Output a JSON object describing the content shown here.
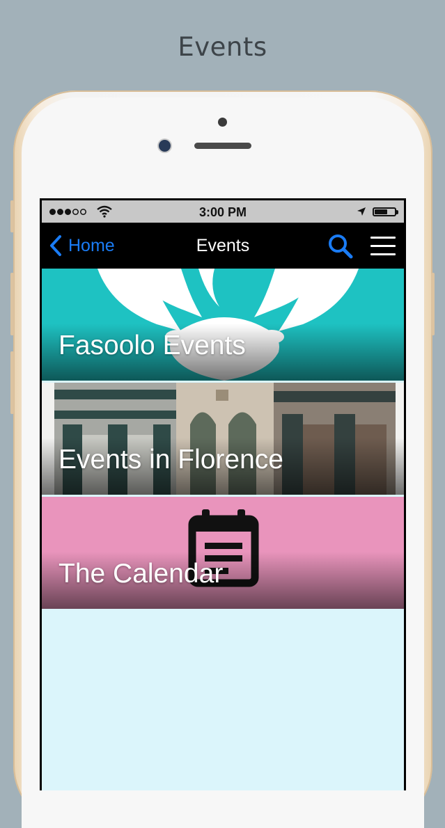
{
  "page": {
    "title": "Events"
  },
  "status_bar": {
    "time": "3:00 PM"
  },
  "nav": {
    "back_label": "Home",
    "title": "Events"
  },
  "tiles": [
    {
      "label": "Fasoolo Events",
      "bg_color": "#1ec2c2",
      "icon": "antlers-graphic"
    },
    {
      "label": "Events in Florence",
      "bg_color": "#8d8b85",
      "icon": "florence-facade-image"
    },
    {
      "label": "The Calendar",
      "bg_color": "#e994bc",
      "icon": "calendar-icon"
    }
  ],
  "colors": {
    "accent": "#1a7cf5",
    "nav_bg": "#000000",
    "screen_bg": "#dbf5fb",
    "backdrop": "#a2b1b9"
  }
}
